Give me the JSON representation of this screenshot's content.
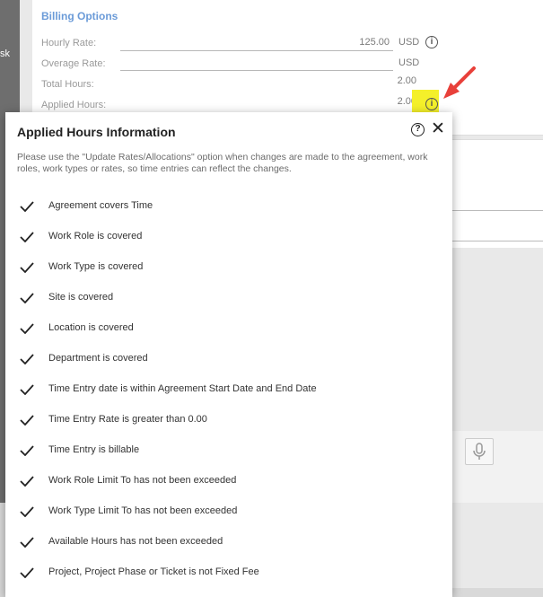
{
  "background": {
    "left_strip_text": "sk"
  },
  "billing": {
    "title": "Billing Options",
    "hourly_rate_label": "Hourly Rate:",
    "hourly_rate_value": "125.00",
    "hourly_rate_currency": "USD",
    "overage_rate_label": "Overage Rate:",
    "overage_rate_value": "",
    "overage_rate_currency": "USD",
    "total_hours_label": "Total Hours:",
    "total_hours_value": "2.00",
    "applied_hours_label": "Applied Hours:",
    "applied_hours_value": "2.00",
    "info_icon": "info-icon",
    "highlight_color": "#f4f02a",
    "arrow_color": "#e8403a"
  },
  "dialog": {
    "title": "Applied Hours Information",
    "help_icon": "help-circle-icon",
    "close_icon": "close-icon",
    "description": "Please use the \"Update Rates/Allocations\" option when changes are made to the agreement, work roles, work types or rates, so time entries can reflect the changes.",
    "checks": [
      "Agreement covers Time",
      "Work Role is covered",
      "Work Type is covered",
      "Site is covered",
      "Location is covered",
      "Department is covered",
      "Time Entry date is within Agreement Start Date and End Date",
      "Time Entry Rate is greater than 0.00",
      "Time Entry is billable",
      "Work Role Limit To has not been exceeded",
      "Work Type Limit To has not been exceeded",
      "Available Hours has not been exceeded",
      "Project, Project Phase or Ticket is not Fixed Fee"
    ]
  }
}
